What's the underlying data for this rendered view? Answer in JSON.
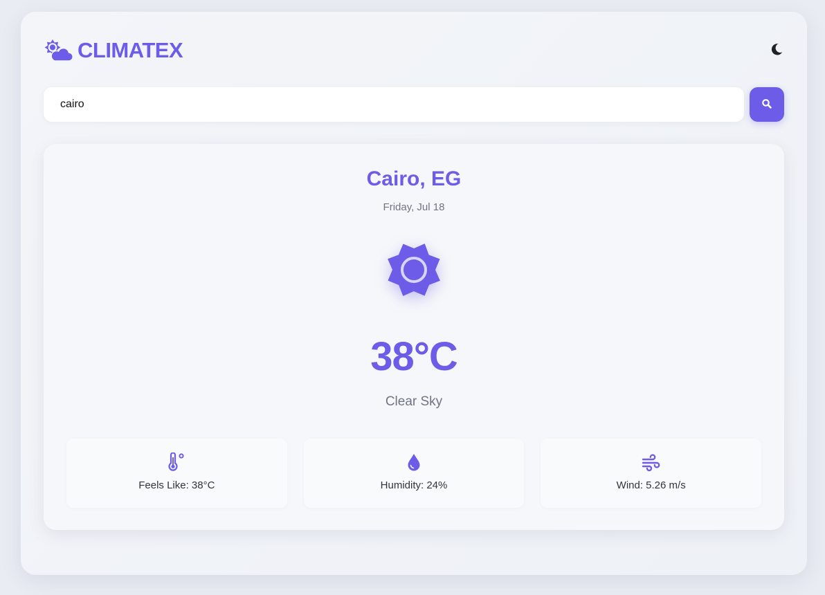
{
  "header": {
    "brand_name": "CLIMATEX",
    "brand_icon": "sun-behind-cloud-icon",
    "theme_toggle_icon": "moon-icon"
  },
  "search": {
    "value": "cairo",
    "button_icon": "search-icon"
  },
  "weather": {
    "city": "Cairo, EG",
    "date": "Friday, Jul 18",
    "icon": "sun-icon",
    "temperature": "38°C",
    "condition": "Clear Sky"
  },
  "stats": [
    {
      "icon": "thermometer-icon",
      "label": "Feels Like: 38°C"
    },
    {
      "icon": "water-drop-icon",
      "label": "Humidity: 24%"
    },
    {
      "icon": "wind-icon",
      "label": "Wind: 5.26 m/s"
    }
  ],
  "colors": {
    "accent": "#6c5ce7",
    "background": "#e9ecf2",
    "card": "#f6f7fa"
  }
}
